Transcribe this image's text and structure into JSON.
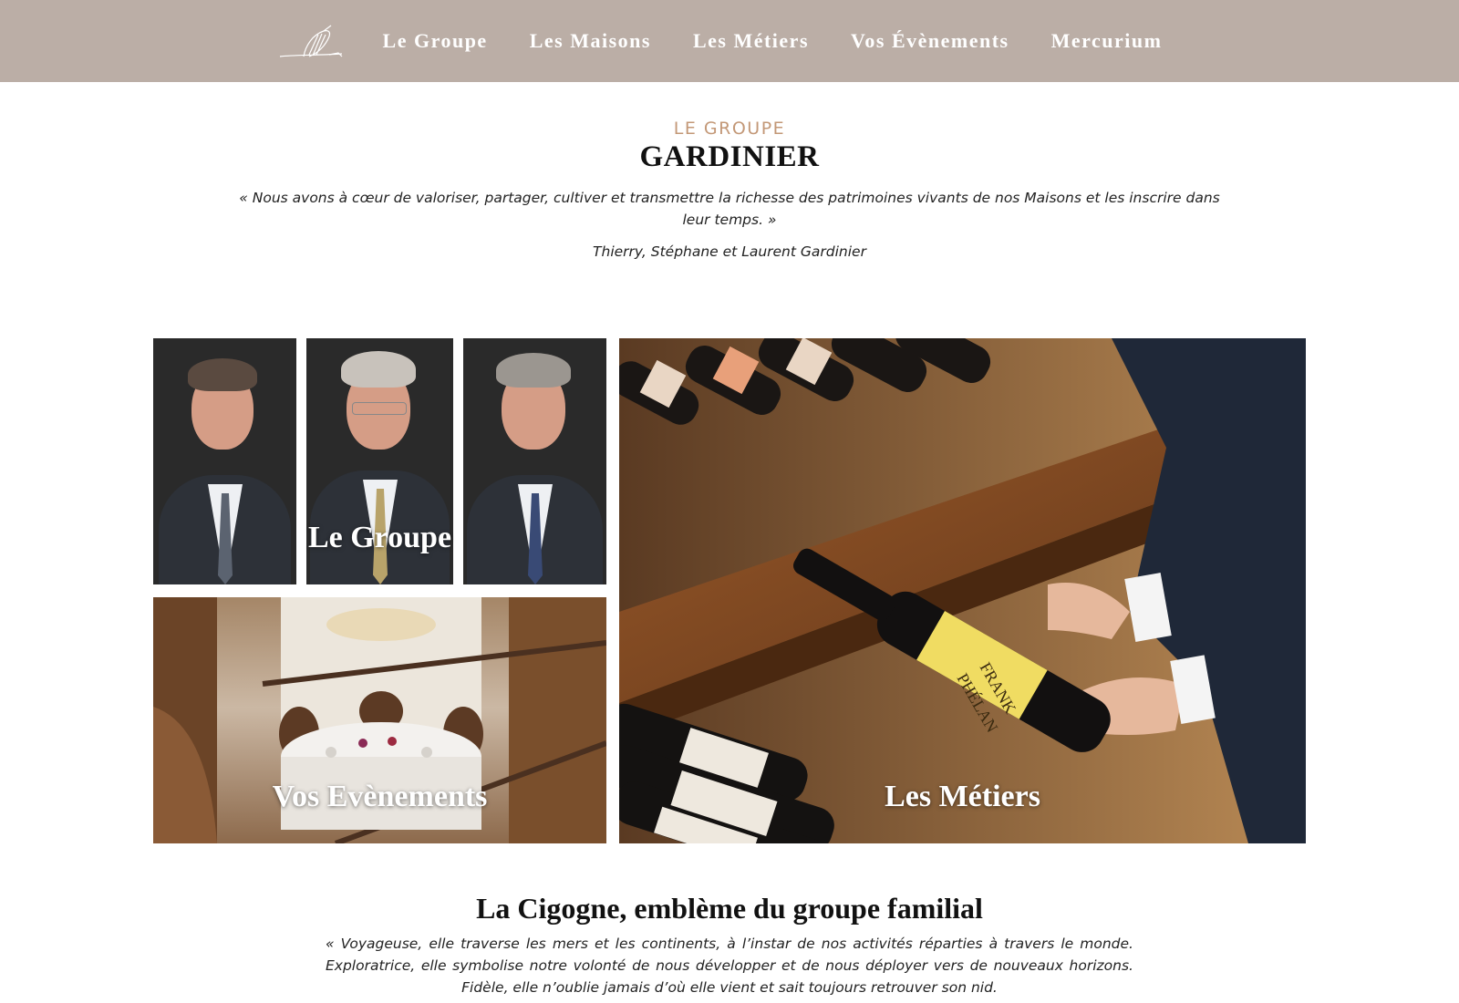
{
  "nav": {
    "items": [
      "Le Groupe",
      "Les Maisons",
      "Les Métiers",
      "Vos Évènements",
      "Mercurium"
    ]
  },
  "intro": {
    "eyebrow": "LE GROUPE",
    "title": "GARDINIER",
    "quote": "« Nous avons à cœur de valoriser, partager, cultiver et transmettre la richesse des patrimoines vivants de nos Maisons et les inscrire dans leur temps. »",
    "signature": "Thierry, Stéphane et Laurent Gardinier"
  },
  "tiles": {
    "groupe": "Le Groupe",
    "evenements": "Vos Evènements",
    "metiers": "Les Métiers"
  },
  "bottle": {
    "label_line1": "FRANK",
    "label_line2": "PHÉLAN"
  },
  "cigogne": {
    "title": "La Cigogne, emblème du groupe familial",
    "quote": "« Voyageuse, elle traverse les mers et les continents, à l’instar de nos activités réparties à travers le monde. Exploratrice, elle symbolise notre volonté de nous développer et de nous déployer vers de nouveaux horizons. Fidèle, elle n’oublie jamais d’où elle vient et sait toujours retrouver son nid."
  },
  "colors": {
    "header_bg": "#bbaea6",
    "eyebrow": "#c39877"
  }
}
